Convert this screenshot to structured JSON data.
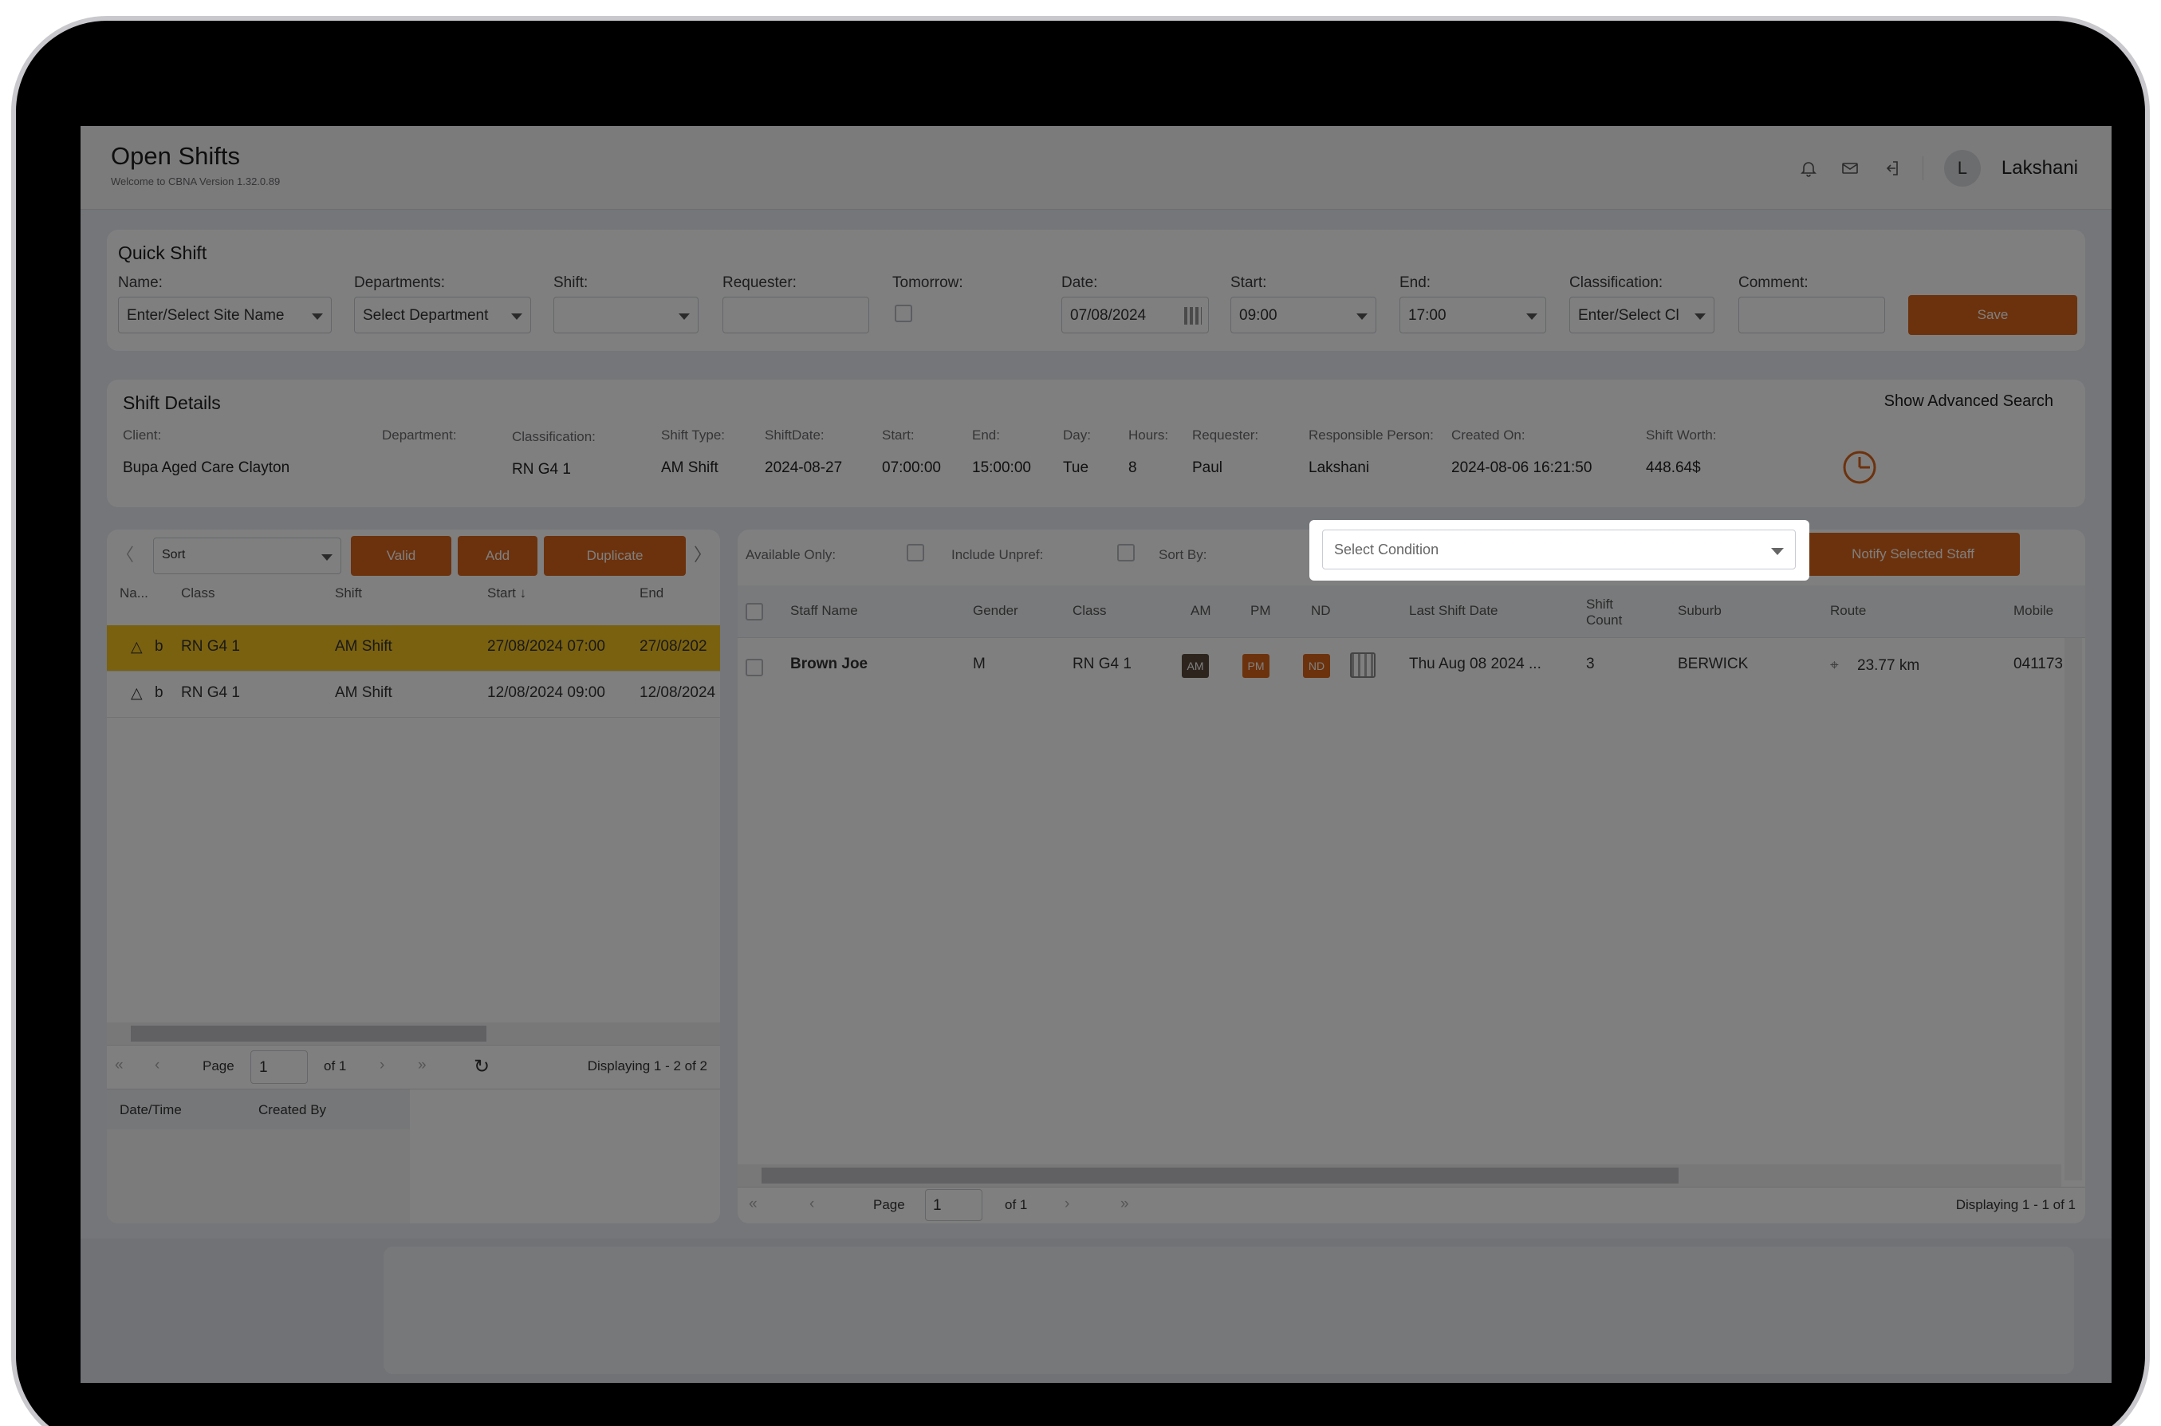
{
  "header": {
    "title": "Open Shifts",
    "subtitle": "Welcome to CBNA Version 1.32.0.89",
    "avatar_initial": "L",
    "username": "Lakshani"
  },
  "quick_shift": {
    "title": "Quick Shift",
    "name_label": "Name:",
    "name_value": "Enter/Select Site Name",
    "departments_label": "Departments:",
    "departments_value": "Select Department",
    "shift_label": "Shift:",
    "requester_label": "Requester:",
    "tomorrow_label": "Tomorrow:",
    "date_label": "Date:",
    "date_value": "07/08/2024",
    "start_label": "Start:",
    "start_value": "09:00",
    "end_label": "End:",
    "end_value": "17:00",
    "classification_label": "Classification:",
    "classification_value": "Enter/Select Cl",
    "comment_label": "Comment:",
    "save_label": "Save"
  },
  "shift_details": {
    "title": "Shift Details",
    "advanced_search": "Show Advanced Search",
    "labels": {
      "client": "Client:",
      "department": "Department:",
      "classification": "Classification:",
      "shift_type": "Shift Type:",
      "shift_date": "ShiftDate:",
      "start": "Start:",
      "end": "End:",
      "day": "Day:",
      "hours": "Hours:",
      "requester": "Requester:",
      "responsible": "Responsible Person:",
      "created_on": "Created On:",
      "shift_worth": "Shift Worth:"
    },
    "values": {
      "client": "Bupa Aged Care Clayton",
      "classification": "RN G4 1",
      "shift_type": "AM Shift",
      "shift_date": "2024-08-27",
      "start": "07:00:00",
      "end": "15:00:00",
      "day": "Tue",
      "hours": "8",
      "requester": "Paul",
      "responsible": "Lakshani",
      "created_on": "2024-08-06  16:21:50",
      "shift_worth": "448.64$"
    }
  },
  "left_panel": {
    "sort_placeholder": "Sort",
    "valid_label": "Valid",
    "add_label": "Add",
    "duplicate_label": "Duplicate",
    "columns": [
      "Na...",
      "Class",
      "Shift",
      "Start",
      "End"
    ],
    "rows": [
      {
        "na": "b",
        "class": "RN G4 1",
        "shift": "AM Shift",
        "start": "27/08/2024 07:00",
        "end": "27/08/202"
      },
      {
        "na": "b",
        "class": "RN G4 1",
        "shift": "AM Shift",
        "start": "12/08/2024 09:00",
        "end": "12/08/2024"
      }
    ],
    "pager": {
      "page_label": "Page",
      "page_value": "1",
      "of_label": "of 1",
      "displaying": "Displaying 1 - 2 of 2"
    },
    "history_columns": [
      "Date/Time",
      "Created By"
    ]
  },
  "right_panel": {
    "available_only": "Available Only:",
    "include_unpref": "Include Unpref:",
    "sort_by": "Sort By:",
    "condition_placeholder": "Select Condition",
    "notify_label": "Notify Selected Staff",
    "columns": [
      "Staff Name",
      "Gender",
      "Class",
      "AM",
      "PM",
      "ND",
      "Last Shift Date",
      "Shift Count",
      "Suburb",
      "Route",
      "Mobile"
    ],
    "rows": [
      {
        "name": "Brown Joe",
        "gender": "M",
        "class": "RN G4 1",
        "am": "AM",
        "pm": "PM",
        "nd": "ND",
        "last_shift": "Thu Aug 08 2024 ...",
        "count": "3",
        "suburb": "BERWICK",
        "route": "23.77 km",
        "mobile": "041173"
      }
    ],
    "pager": {
      "page_label": "Page",
      "page_value": "1",
      "of_label": "of 1",
      "displaying": "Displaying 1 - 1 of 1"
    }
  },
  "colors": {
    "accent": "#d9651a",
    "selected_row": "#f5c31e"
  }
}
